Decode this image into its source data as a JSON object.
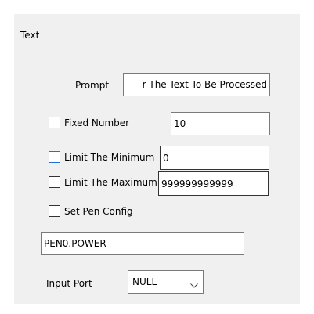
{
  "section": {
    "title": "Text"
  },
  "prompt": {
    "label": "Prompt",
    "value": "r The Text To Be Processed"
  },
  "fixed_number": {
    "label": "Fixed Number",
    "checked": false,
    "value": "10"
  },
  "limit_min": {
    "label": "Limit The Minimum",
    "checked": false,
    "value": "0"
  },
  "limit_max": {
    "label": "Limit The Maximum",
    "checked": false,
    "value": "999999999999"
  },
  "set_pen_config": {
    "label": "Set Pen Config",
    "checked": false
  },
  "pen_power": {
    "value": "PEN0.POWER"
  },
  "input_port": {
    "label": "Input Port",
    "selected": "NULL"
  },
  "colors": {
    "panel_bg": "#f0f0f0",
    "focus_border": "#1f6fd6"
  }
}
